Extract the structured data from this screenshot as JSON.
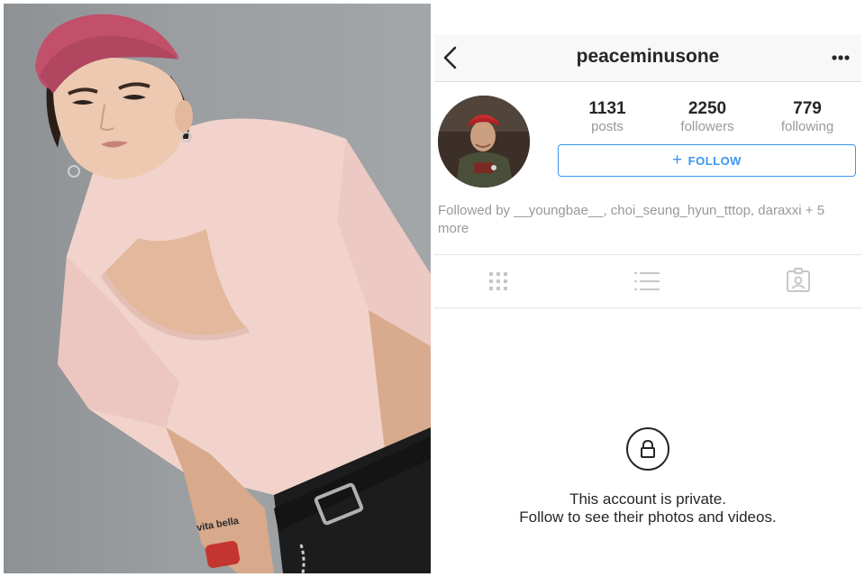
{
  "profile": {
    "username": "peaceminusone",
    "stats": [
      {
        "value": "1131",
        "label": "posts"
      },
      {
        "value": "2250",
        "label": "followers"
      },
      {
        "value": "779",
        "label": "following"
      }
    ],
    "follow_button": {
      "icon": "plus-icon",
      "label": "FOLLOW"
    },
    "followed_by": "Followed by __youngbae__, choi_seung_hyun_tttop, daraxxi + 5 more",
    "private_notice": {
      "icon": "lock-icon",
      "line1": "This account is private.",
      "line2": "Follow to see their photos and videos."
    }
  },
  "nav": {
    "back_icon": "chevron-left-icon",
    "more_icon": "more-dots-icon"
  },
  "tabs": [
    "grid-icon",
    "list-icon",
    "tagged-icon"
  ],
  "photo": {
    "tattoo_text": "vita bella"
  },
  "colors": {
    "accent": "#3897f0",
    "text": "#262626",
    "muted": "#999999",
    "divider": "#dbdbdb"
  }
}
